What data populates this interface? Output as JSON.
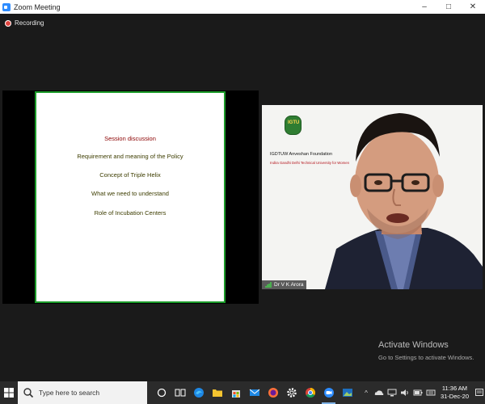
{
  "window": {
    "title": "Zoom Meeting"
  },
  "recording": {
    "label": "Recording"
  },
  "slide": {
    "lines": [
      "Session discussion",
      "Requirement and meaning of the Policy",
      "Concept of Triple Helix",
      "What we need to understand",
      "Role of Incubation Centers"
    ]
  },
  "video": {
    "logo_text": "IGTU",
    "org_name": "IGDTUW Anveshan Foundation",
    "org_sub": "Indira Gandhi Delhi Technical University for Women",
    "participant_name": "Dr V K Arora"
  },
  "activate": {
    "title": "Activate Windows",
    "subtitle": "Go to Settings to activate Windows."
  },
  "taskbar": {
    "search_placeholder": "Type here to search",
    "time": "11:36 AM",
    "date": "31-Dec-20"
  },
  "colors": {
    "accent_green": "#1c9c2a",
    "slide_heading": "#8b0000",
    "slide_text": "#3d3d00",
    "recording_red": "#e0443e"
  }
}
